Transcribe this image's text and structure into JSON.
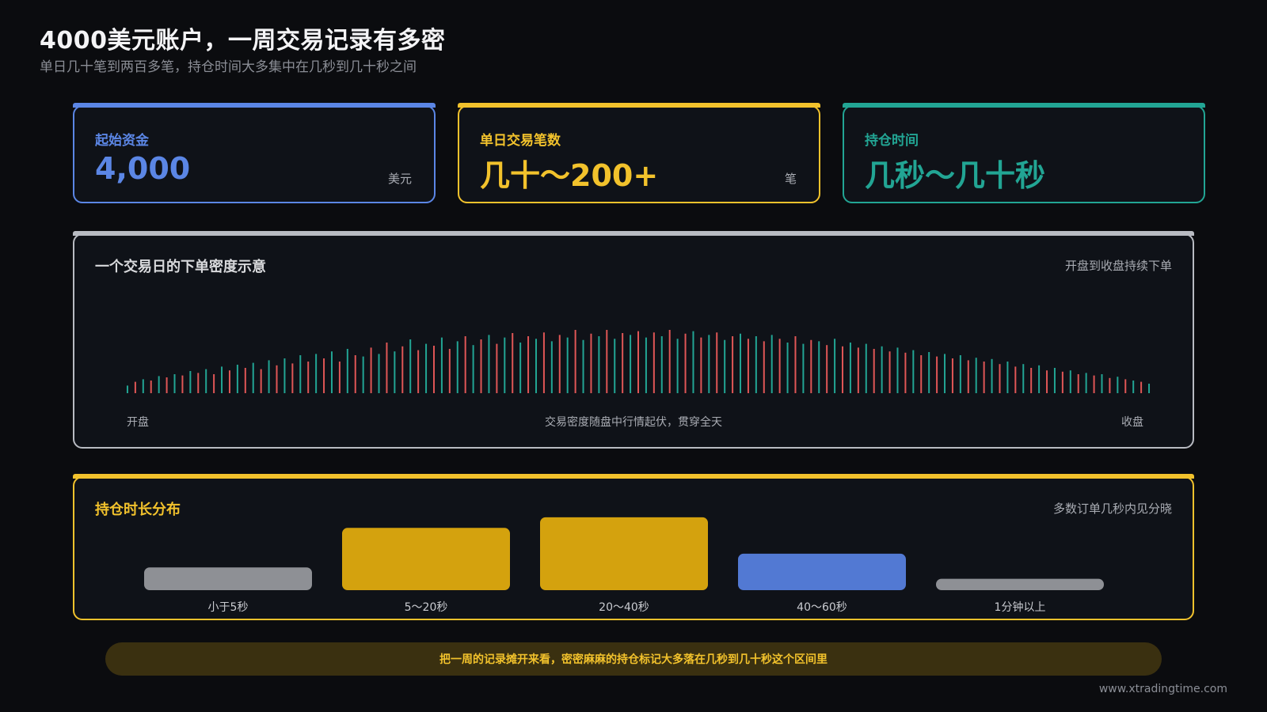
{
  "header": {
    "title": "4000美元账户，一周交易记录有多密",
    "subtitle": "单日几十笔到两百多笔，持仓时间大多集中在几秒到几十秒之间"
  },
  "cards": [
    {
      "label": "起始资金",
      "value": "4,000",
      "unit": "美元",
      "color": "#5b86e5"
    },
    {
      "label": "单日交易笔数",
      "value": "几十～200+",
      "unit": "笔",
      "color": "#f2c22c"
    },
    {
      "label": "持仓时间",
      "value": "几秒～几十秒",
      "unit": "",
      "color": "#22a594"
    }
  ],
  "density_panel": {
    "title": "一个交易日的下单密度示意",
    "note": "开盘到收盘持续下单",
    "left_label": "开盘",
    "center_label": "交易密度随盘中行情起伏，贯穿全天",
    "right_label": "收盘",
    "border_color": "#b8bbc2",
    "colors": {
      "up": "#22a594",
      "down": "#e05656"
    }
  },
  "distribution_panel": {
    "title": "持仓时长分布",
    "note": "多数订单几秒内见分晓",
    "border_color": "#f2c22c"
  },
  "chart_data": [
    {
      "type": "bar",
      "title": "一个交易日的下单密度示意",
      "description": "schematic: order density across the trading day, alternating green/red",
      "ylim": [
        0,
        1
      ],
      "values": [
        0.12,
        0.18,
        0.22,
        0.2,
        0.27,
        0.25,
        0.3,
        0.28,
        0.35,
        0.32,
        0.38,
        0.3,
        0.42,
        0.36,
        0.45,
        0.4,
        0.48,
        0.38,
        0.52,
        0.44,
        0.55,
        0.47,
        0.6,
        0.5,
        0.62,
        0.55,
        0.66,
        0.5,
        0.7,
        0.6,
        0.58,
        0.72,
        0.62,
        0.8,
        0.66,
        0.74,
        0.85,
        0.68,
        0.78,
        0.75,
        0.88,
        0.7,
        0.82,
        0.9,
        0.76,
        0.85,
        0.92,
        0.78,
        0.88,
        0.95,
        0.8,
        0.9,
        0.86,
        0.96,
        0.82,
        0.92,
        0.88,
        1.0,
        0.84,
        0.94,
        0.9,
        1.0,
        0.86,
        0.95,
        0.92,
        0.98,
        0.88,
        0.96,
        0.9,
        1.0,
        0.86,
        0.94,
        0.98,
        0.88,
        0.92,
        0.96,
        0.84,
        0.9,
        0.94,
        0.86,
        0.9,
        0.82,
        0.92,
        0.86,
        0.8,
        0.9,
        0.78,
        0.84,
        0.82,
        0.76,
        0.86,
        0.74,
        0.8,
        0.72,
        0.78,
        0.7,
        0.74,
        0.66,
        0.72,
        0.64,
        0.68,
        0.6,
        0.65,
        0.58,
        0.62,
        0.55,
        0.6,
        0.52,
        0.56,
        0.5,
        0.54,
        0.46,
        0.5,
        0.42,
        0.46,
        0.4,
        0.44,
        0.36,
        0.4,
        0.34,
        0.36,
        0.3,
        0.32,
        0.28,
        0.3,
        0.24,
        0.26,
        0.22,
        0.2,
        0.18,
        0.15
      ]
    },
    {
      "type": "bar",
      "title": "持仓时长分布",
      "categories": [
        "小于5秒",
        "5～20秒",
        "20～40秒",
        "40～60秒",
        "1分钟以上"
      ],
      "values": [
        0.3,
        0.82,
        0.96,
        0.48,
        0.15
      ],
      "colors": [
        "#8e9095",
        "#d4a20e",
        "#d4a20e",
        "#5279d3",
        "#8e9095"
      ],
      "ylim": [
        0,
        1
      ]
    }
  ],
  "banner": {
    "text": "把一周的记录摊开来看，密密麻麻的持仓标记大多落在几秒到几十秒这个区间里"
  },
  "footer": {
    "url": "www.xtradingtime.com"
  }
}
